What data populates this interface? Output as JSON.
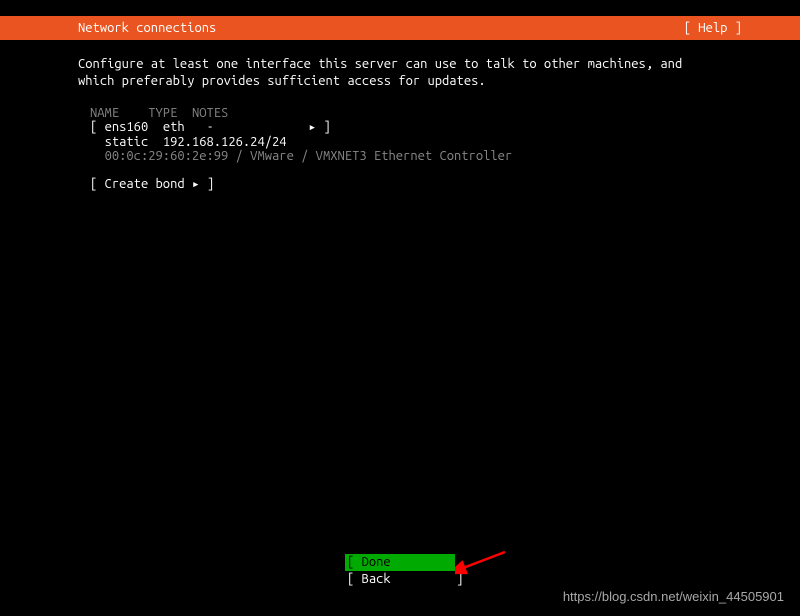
{
  "header": {
    "title": "Network connections",
    "help": "[ Help ]"
  },
  "instruction": "Configure at least one interface this server can use to talk to other machines, and which preferably provides sufficient access for updates.",
  "table": {
    "col_name": "NAME",
    "col_type": "TYPE",
    "col_notes": "NOTES",
    "iface_name": "ens160",
    "iface_type": "eth",
    "iface_notes": "-",
    "addr_mode": "static",
    "addr": "192.168.126.24/24",
    "hw_info": "00:0c:29:60:2e:99 / VMware / VMXNET3 Ethernet Controller"
  },
  "create_bond": "[ Create bond ▸ ]",
  "buttons": {
    "done_open": "[",
    "done_label": "Done",
    "done_close": "]",
    "back_open": "[",
    "back_label": "Back",
    "back_close": "]"
  },
  "watermark": "https://blog.csdn.net/weixin_44505901"
}
